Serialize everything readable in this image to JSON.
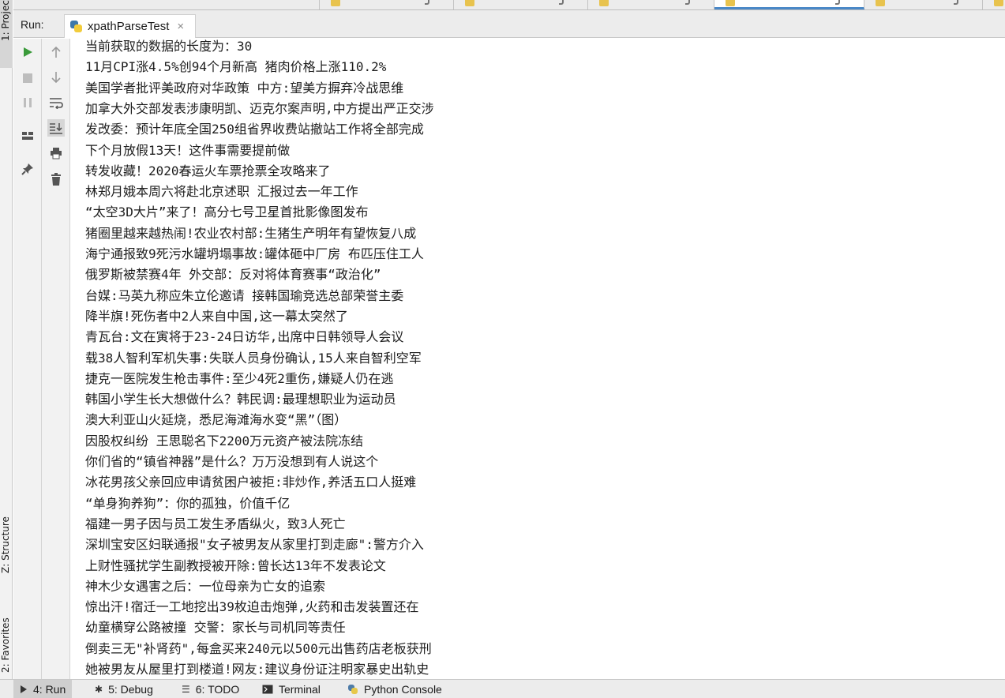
{
  "left_strip": {
    "project_tab": "1: Project",
    "structure_tab": "Z: Structure",
    "favorites_tab": "2: Favorites"
  },
  "run_panel": {
    "label": "Run:",
    "config_tab": "xpathParseTest"
  },
  "console_lines": [
    "当前获取的数据的长度为：30",
    "11月CPI涨4.5%创94个月新高 猪肉价格上涨110.2%",
    "美国学者批评美政府对华政策 中方:望美方摒弃冷战思维",
    "加拿大外交部发表涉康明凯、迈克尔案声明,中方提出严正交涉",
    "发改委：预计年底全国250组省界收费站撤站工作将全部完成",
    "下个月放假13天！这件事需要提前做",
    "转发收藏！2020春运火车票抢票全攻略来了",
    "林郑月娥本周六将赴北京述职 汇报过去一年工作",
    "“太空3D大片”来了！高分七号卫星首批影像图发布",
    "猪圈里越来越热闹!农业农村部:生猪生产明年有望恢复八成",
    "海宁通报致9死污水罐坍塌事故:罐体砸中厂房 布匹压住工人",
    "俄罗斯被禁赛4年 外交部：反对将体育赛事“政治化”",
    "台媒:马英九称应朱立伦邀请 接韩国瑜竞选总部荣誉主委",
    "降半旗!死伤者中2人来自中国,这一幕太突然了",
    "青瓦台:文在寅将于23-24日访华,出席中日韩领导人会议",
    "载38人智利军机失事:失联人员身份确认,15人来自智利空军",
    "捷克一医院发生枪击事件:至少4死2重伤,嫌疑人仍在逃",
    "韩国小学生长大想做什么？韩民调:最理想职业为运动员",
    "澳大利亚山火延烧，悉尼海滩海水变“黑”（图）",
    "因股权纠纷 王思聪名下2200万元资产被法院冻结",
    "你们省的“镇省神器”是什么？万万没想到有人说这个",
    "冰花男孩父亲回应申请贫困户被拒:非炒作,养活五口人挺难",
    "“单身狗养狗”：你的孤独，价值千亿",
    "福建一男子因与员工发生矛盾纵火，致3人死亡",
    "深圳宝安区妇联通报\"女子被男友从家里打到走廊\":警方介入",
    "上财性骚扰学生副教授被开除:曾长达13年不发表论文",
    "神木少女遇害之后：一位母亲为亡女的追索",
    "惊出汗!宿迁一工地挖出39枚迫击炮弹,火药和击发装置还在",
    "幼童横穿公路被撞 交警：家长与司机同等责任",
    "倒卖三无\"补肾药\",每盒买来240元以500元出售药店老板获刑",
    "她被男友从屋里打到楼道!网友:建议身份证注明家暴史出轨史"
  ],
  "bottom_bar": {
    "run": "4: Run",
    "debug": "5: Debug",
    "todo": "6: TODO",
    "terminal": "Terminal",
    "python_console": "Python Console"
  },
  "icons": {
    "run": "play-icon",
    "stop": "stop-icon",
    "pause": "pause-icon",
    "layout": "layout-icon",
    "pin": "pin-icon",
    "up": "arrow-up-icon",
    "down": "arrow-down-icon",
    "wrap": "soft-wrap-icon",
    "scroll": "scroll-to-end-icon",
    "print": "print-icon",
    "trash": "trash-icon"
  },
  "colors": {
    "run_green": "#3a9a3a",
    "background": "#ffffff",
    "toolbar": "#f2f2f2"
  }
}
